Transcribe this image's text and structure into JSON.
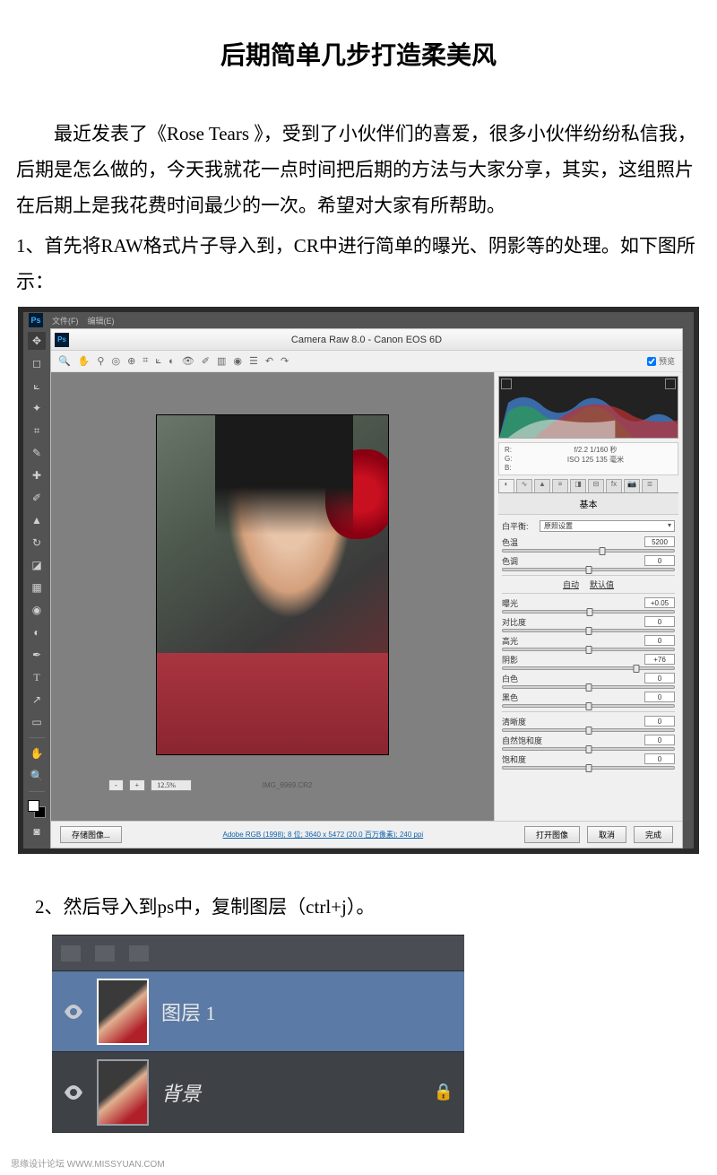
{
  "article": {
    "title": "后期简单几步打造柔美风",
    "intro": "最近发表了《Rose Tears 》，受到了小伙伴们的喜爱，很多小伙伴纷纷私信我，后期是怎么做的，今天我就花一点时间把后期的方法与大家分享，其实，这组照片在后期上是我花费时间最少的一次。希望对大家有所帮助。",
    "step1": "1、首先将RAW格式片子导入到，CR中进行简单的曝光、阴影等的处理。如下图所示：",
    "step2": "2、然后导入到ps中，复制图层（ctrl+j）。"
  },
  "ps_menu": {
    "items": [
      "文件(F)",
      "编辑(E)"
    ]
  },
  "cr": {
    "title": "Camera Raw 8.0  -  Canon EOS 6D",
    "preview_label": "预览",
    "zoom": "12.5%",
    "filename": "IMG_6969.CR2",
    "profile_link": "Adobe RGB (1998); 8 位; 3640 x 5472 (20.0 百万像素); 240 ppi",
    "exif": {
      "rgb": [
        "R:",
        "G:",
        "B:"
      ],
      "line1": "f/2.2  1/160 秒",
      "line2": "ISO 125  135 毫米"
    },
    "section": "基本",
    "wb_label": "白平衡:",
    "wb_value": "原照设置",
    "auto": "自动",
    "default": "默认值",
    "sliders": {
      "temp": {
        "label": "色温",
        "value": "5200",
        "pos": 58
      },
      "tint": {
        "label": "色调",
        "value": "0",
        "pos": 50
      },
      "exp": {
        "label": "曝光",
        "value": "+0.05",
        "pos": 51
      },
      "contr": {
        "label": "对比度",
        "value": "0",
        "pos": 50
      },
      "high": {
        "label": "高光",
        "value": "0",
        "pos": 50
      },
      "shad": {
        "label": "阴影",
        "value": "+76",
        "pos": 78
      },
      "white": {
        "label": "白色",
        "value": "0",
        "pos": 50
      },
      "black": {
        "label": "黑色",
        "value": "0",
        "pos": 50
      },
      "clar": {
        "label": "清晰度",
        "value": "0",
        "pos": 50
      },
      "vib": {
        "label": "自然饱和度",
        "value": "0",
        "pos": 50
      },
      "sat": {
        "label": "饱和度",
        "value": "0",
        "pos": 50
      }
    },
    "buttons": {
      "save": "存储图像...",
      "open": "打开图像",
      "cancel": "取消",
      "done": "完成"
    }
  },
  "layers": {
    "layer1": "图层 1",
    "background": "背景"
  },
  "watermark": "思缘设计论坛   WWW.MISSYUAN.COM"
}
